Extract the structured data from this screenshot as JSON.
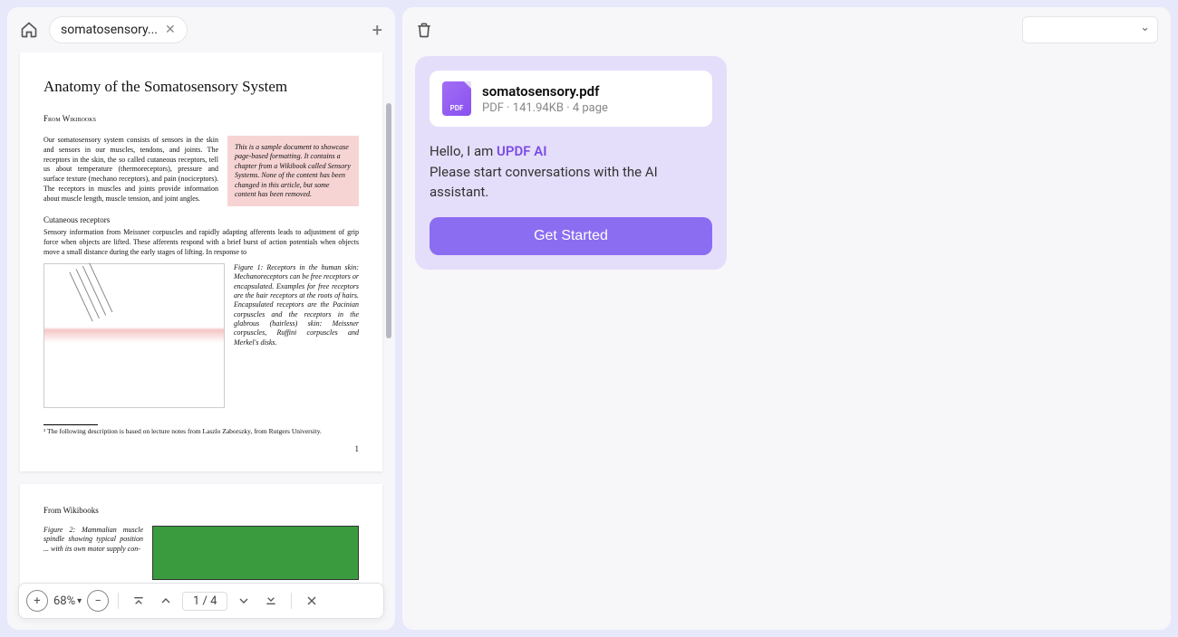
{
  "header": {
    "tab_title": "somatosensory...",
    "close_glyph": "✕",
    "plus_glyph": "+"
  },
  "document": {
    "page1": {
      "title": "Anatomy of the Somatosensory System",
      "source": "From Wikibooks",
      "intro": "Our somatosensory system consists of sensors in the skin and sensors in our muscles, tendons, and joints. The receptors in the skin, the so called cutaneous receptors, tell us about temperature (thermoreceptors), pressure and surface texture (mechano receptors), and pain (nociceptors). The receptors in muscles and joints provide information about muscle length, muscle tension, and joint angles.",
      "note": "This is a sample document to showcase page-based formatting. It contains a chapter from a Wikibook called Sensory Systems. None of the content has been changed in this article, but some content has been removed.",
      "cutaneous_head": "Cutaneous receptors",
      "cutaneous_body": "Sensory information from Meissner corpuscles and rapidly adapting afferents leads to adjustment of grip force when objects are lifted. These afferents respond with a brief burst of action potentials when objects move a small distance during the early stages of lifting. In response to",
      "fig1_caption": "Figure 1: Receptors in the human skin: Mechanoreceptors can be free receptors or encapsulated. Examples for free receptors are the hair receptors at the roots of hairs. Encapsulated receptors are the Pacinian corpuscles and the receptors in the glabrous (hairless) skin: Meissner corpuscles, Ruffini corpuscles and Merkel's disks.",
      "footnote": "¹ The following description is based on lecture notes from Laszlo Zaborszky, from Rutgers University.",
      "pagenum": "1"
    },
    "page2": {
      "header": "From Wikibooks",
      "fig2_caption": "Figure 2: Mammalian muscle spindle showing typical position ... with its own motor supply con-"
    }
  },
  "toolbar": {
    "zoom": "68%",
    "page_current": "1",
    "page_sep": "/",
    "page_total": "4"
  },
  "ai_panel": {
    "model_selected": "",
    "file_name": "somatosensory.pdf",
    "file_meta": "PDF · 141.94KB · 4 page",
    "hello_prefix": "Hello, I am ",
    "ai_name": "UPDF AI",
    "instruction": "Please start conversations with the AI assistant.",
    "get_started": "Get Started"
  }
}
